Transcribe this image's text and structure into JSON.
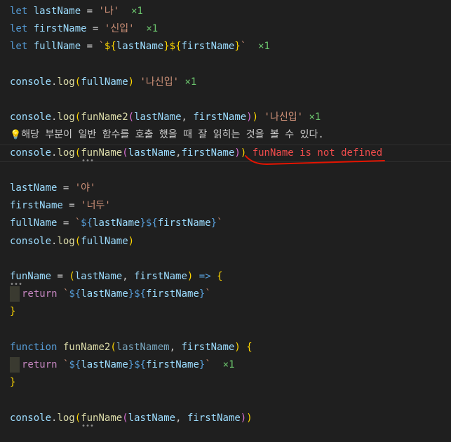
{
  "code_lines": {
    "l1": {
      "kw": "let",
      "var": "lastName",
      "op": " = ",
      "str": "'나'",
      "count": "×1"
    },
    "l2": {
      "kw": "let",
      "var": "firstName",
      "op": " = ",
      "str": "'신입'",
      "count": "×1"
    },
    "l3": {
      "kw": "let",
      "var": "fullName",
      "op": " = ",
      "tpl_open": "`",
      "interp_open1": "${",
      "v1": "lastName",
      "interp_close1": "}",
      "interp_open2": "${",
      "v2": "firstName",
      "interp_close2": "}",
      "tpl_close": "`",
      "count": "×1"
    },
    "l5": {
      "obj": "console",
      "dot": ".",
      "fn": "log",
      "p_open": "(",
      "arg": "fullName",
      "p_close": ")",
      "out": "'나신입'",
      "count": "×1"
    },
    "l7": {
      "obj": "console",
      "dot": ".",
      "fn": "log",
      "p_open": "(",
      "fn2": "funName2",
      "p2_open": "(",
      "a1": "lastName",
      "comma": ", ",
      "a2": "firstName",
      "p2_close": ")",
      "p_close": ")",
      "out": "'나신입'",
      "count": "×1"
    },
    "l8": {
      "icon": "💡",
      "text": "해당 부분이 일반 함수를 호출 했을 때 잘 읽히는 것을 볼 수 있다."
    },
    "l9": {
      "obj": "console",
      "dot": ".",
      "fn": "log",
      "p_open": "(",
      "fn2": "funName",
      "p2_open": "(",
      "a1": "lastName",
      "comma": ",",
      "a2": "firstName",
      "p2_close": ")",
      "p_close": ")",
      "error": "funName is not defined"
    },
    "l11": {
      "var": "lastName",
      "op": " = ",
      "str": "'야'"
    },
    "l12": {
      "var": "firstName",
      "op": " = ",
      "str": "'너두'"
    },
    "l13": {
      "var": "fullName",
      "op": " = ",
      "tpl_open": "`",
      "interp_open1": "${",
      "v1": "lastName",
      "interp_close1": "}",
      "interp_open2": "${",
      "v2": "firstName",
      "interp_close2": "}",
      "tpl_close": "`"
    },
    "l14": {
      "obj": "console",
      "dot": ".",
      "fn": "log",
      "p_open": "(",
      "arg": "fullName",
      "p_close": ")"
    },
    "l16": {
      "fn": "funName",
      "op": " = ",
      "p_open": "(",
      "a1": "lastName",
      "comma": ", ",
      "a2": "firstName",
      "p_close": ")",
      "arrow": " => ",
      "brace": "{"
    },
    "l17": {
      "kw": "return",
      "tpl_open": "`",
      "interp_open1": "${",
      "v1": "lastName",
      "interp_close1": "}",
      "interp_open2": "${",
      "v2": "firstName",
      "interp_close2": "}",
      "tpl_close": "`"
    },
    "l18": {
      "brace": "}"
    },
    "l20": {
      "kw": "function",
      "fn": "funName2",
      "p_open": "(",
      "a1": "lastNamem",
      "comma": ", ",
      "a2": "firstName",
      "p_close": ")",
      "brace": "{"
    },
    "l21": {
      "kw": "return",
      "tpl_open": "`",
      "interp_open1": "${",
      "v1": "lastName",
      "interp_close1": "}",
      "interp_open2": "${",
      "v2": "firstName",
      "interp_close2": "}",
      "tpl_close": "`",
      "count": "×1"
    },
    "l22": {
      "brace": "}"
    },
    "l24": {
      "obj": "console",
      "dot": ".",
      "fn": "log",
      "p_open": "(",
      "fn2": "funName",
      "p2_open": "(",
      "a1": "lastName",
      "comma": ", ",
      "a2": "firstName",
      "p2_close": ")",
      "p_close": ")"
    }
  },
  "colors": {
    "background": "#1f1f1f",
    "error": "#f14c4c",
    "squiggle": "#e51400",
    "quokka_count": "#6bc46d"
  }
}
